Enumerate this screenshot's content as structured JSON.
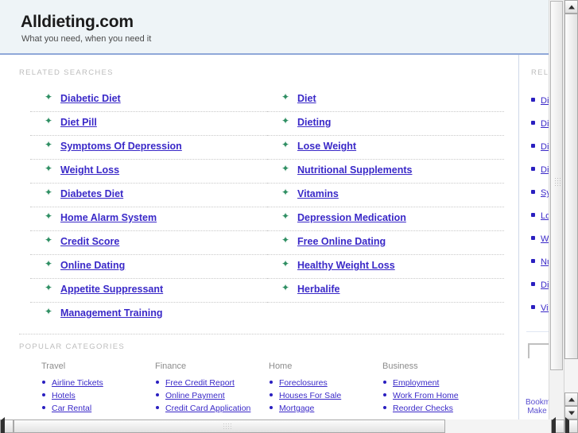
{
  "header": {
    "title": "Alldieting.com",
    "tagline": "What you need, when you need it"
  },
  "main": {
    "related_kicker": "RELATED SEARCHES",
    "related_left": [
      "Diabetic Diet",
      "Diet Pill",
      "Symptoms Of Depression",
      "Weight Loss",
      "Diabetes Diet",
      "Home Alarm System",
      "Credit Score",
      "Online Dating",
      "Appetite Suppressant",
      "Management Training"
    ],
    "related_right": [
      "Diet",
      "Dieting",
      "Lose Weight",
      "Nutritional Supplements",
      "Vitamins",
      "Depression Medication",
      "Free Online Dating",
      "Healthy Weight Loss",
      "Herbalife"
    ],
    "popular_kicker": "POPULAR CATEGORIES",
    "popular_categories": [
      {
        "heading": "Travel",
        "links": [
          "Airline Tickets",
          "Hotels",
          "Car Rental"
        ]
      },
      {
        "heading": "Finance",
        "links": [
          "Free Credit Report",
          "Online Payment",
          "Credit Card Application"
        ]
      },
      {
        "heading": "Home",
        "links": [
          "Foreclosures",
          "Houses For Sale",
          "Mortgage"
        ]
      },
      {
        "heading": "Business",
        "links": [
          "Employment",
          "Work From Home",
          "Reorder Checks"
        ]
      }
    ]
  },
  "sidebar": {
    "kicker": "RELATED",
    "items": [
      "Diabetic Diet",
      "Diet Pill",
      "Diet",
      "Dieting",
      "Symptoms Of Depression",
      "Lose Weight",
      "Weight Loss",
      "Nutritional Supplements",
      "Diabetes Diet",
      "Vitamins"
    ],
    "search_value": "",
    "search_placeholder": "",
    "footer_links": [
      "Bookmark",
      "Make this"
    ]
  },
  "colors": {
    "link": "#3a29c8",
    "header_bg": "#eef4f7",
    "header_rule": "#8fa8d8",
    "star_bullet": "#2f8f63",
    "kicker": "#bdbdbd"
  },
  "icons": {
    "star_bullet": "✦",
    "scroll_up": "scroll-up-arrow-icon",
    "scroll_down": "scroll-down-arrow-icon",
    "scroll_left": "scroll-left-arrow-icon",
    "scroll_right": "scroll-right-arrow-icon"
  }
}
